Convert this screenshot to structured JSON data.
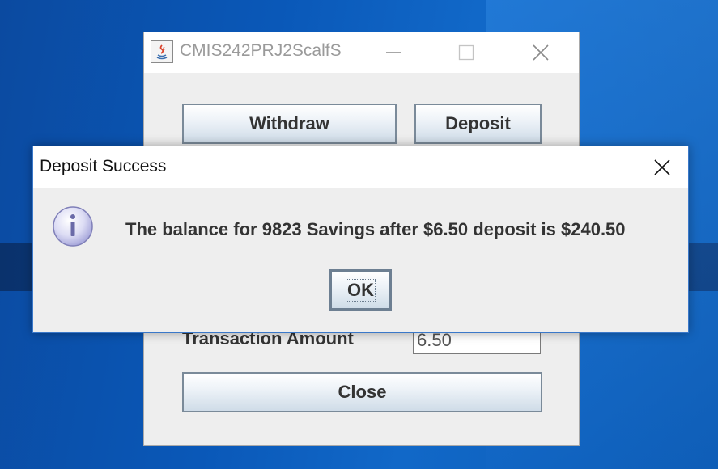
{
  "main_window": {
    "title": "CMIS242PRJ2ScalfS",
    "buttons": {
      "withdraw": "Withdraw",
      "deposit": "Deposit",
      "close": "Close"
    },
    "transaction_amount_label": "Transaction Amount",
    "transaction_amount_value": "6.50",
    "title_controls": [
      "minimize-icon",
      "maximize-icon",
      "close-icon"
    ]
  },
  "dialog": {
    "title": "Deposit Success",
    "message": "The balance for 9823 Savings after $6.50 deposit is $240.50",
    "ok_label": "OK",
    "icon": "info-icon"
  },
  "colors": {
    "desktop": "#0a58b8",
    "dialog_border": "#3a78c9",
    "window_bg": "#eeeeee"
  }
}
